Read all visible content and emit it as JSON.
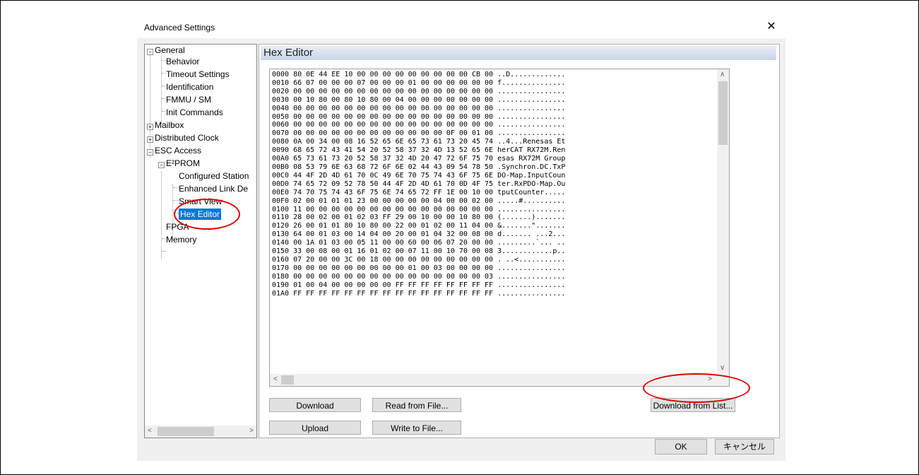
{
  "window": {
    "title": "Advanced Settings",
    "close_glyph": "✕"
  },
  "tree": {
    "items": [
      {
        "label": "General"
      },
      {
        "label": "Behavior"
      },
      {
        "label": "Timeout Settings"
      },
      {
        "label": "Identification"
      },
      {
        "label": "FMMU / SM"
      },
      {
        "label": "Init Commands"
      },
      {
        "label": "Mailbox"
      },
      {
        "label": "Distributed Clock"
      },
      {
        "label": "ESC Access"
      },
      {
        "label": "E²PROM"
      },
      {
        "label": "Configured Station"
      },
      {
        "label": "Enhanced Link De"
      },
      {
        "label": "Smart View"
      },
      {
        "label": "Hex Editor"
      },
      {
        "label": "FPGA"
      },
      {
        "label": "Memory"
      }
    ],
    "selected": "Hex Editor",
    "scroll_left": "<",
    "scroll_right": ">"
  },
  "content": {
    "header": "Hex Editor"
  },
  "hex": {
    "lines": [
      "0000 80 0E 44 EE 10 00 00 00 00 00 00 00 00 00 CB 00 ..D.............",
      "0010 66 07 00 00 00 07 00 00 00 01 00 00 00 00 00 00 f...............",
      "0020 00 00 00 00 00 00 00 00 00 00 00 00 00 00 00 00 ................",
      "0030 00 10 80 00 80 10 80 00 04 00 00 00 00 00 00 00 ................",
      "0040 00 00 00 00 00 00 00 00 00 00 00 00 00 00 00 00 ................",
      "0050 00 00 00 00 00 00 00 00 00 00 00 00 00 00 00 00 ................",
      "0060 00 00 00 00 00 00 00 00 00 00 00 00 00 00 00 00 ................",
      "0070 00 00 00 00 00 00 00 00 00 00 00 00 0F 00 01 00 ................",
      "0080 0A 00 34 00 08 16 52 65 6E 65 73 61 73 20 45 74 ..4...Renesas Et",
      "0090 68 65 72 43 41 54 20 52 58 37 32 4D 13 52 65 6E herCAT RX72M.Ren",
      "00A0 65 73 61 73 20 52 58 37 32 4D 20 47 72 6F 75 70 esas RX72M Group",
      "00B0 08 53 79 6E 63 68 72 6F 6E 02 44 43 09 54 78 50 .Synchron.DC.TxP",
      "00C0 44 4F 2D 4D 61 70 0C 49 6E 70 75 74 43 6F 75 6E DO-Map.InputCoun",
      "00D0 74 65 72 09 52 78 50 44 4F 2D 4D 61 70 0D 4F 75 ter.RxPDO-Map.Ou",
      "00E0 74 70 75 74 43 6F 75 6E 74 65 72 FF 1E 00 10 00 tputCounter.....",
      "00F0 02 00 01 01 01 23 00 00 00 00 00 04 00 00 02 00 .....#..........",
      "0100 11 00 00 00 00 00 00 00 00 00 00 00 00 00 00 00 ................",
      "0110 28 00 02 00 01 02 03 FF 29 00 10 00 00 10 80 00 (.......).......",
      "0120 26 00 01 01 80 10 80 00 22 00 01 02 00 11 04 00 &.......\".......",
      "0130 64 00 01 03 00 14 04 00 20 00 01 04 32 00 08 00 d....... ...2...",
      "0140 00 1A 01 03 00 05 11 00 00 60 00 06 07 20 00 00 .........`... ..",
      "0150 33 00 08 00 01 16 01 02 00 07 11 00 10 70 00 08 3............p..",
      "0160 07 20 00 00 3C 00 18 00 00 00 00 00 00 00 00 00 . ..<...........",
      "0170 00 00 00 00 00 00 00 00 00 01 00 03 00 00 00 00 ................",
      "0180 00 00 00 00 00 00 00 00 00 00 00 00 00 00 00 03 ................",
      "0190 01 00 04 00 00 00 00 00 FF FF FF FF FF FF FF FF ................",
      "01A0 FF FF FF FF FF FF FF FF FF FF FF FF FF FF FF FF ................"
    ],
    "scroll_up": "∧",
    "scroll_down": "∨",
    "scroll_left": "<",
    "scroll_right": ">"
  },
  "buttons": {
    "download": "Download",
    "upload": "Upload",
    "read_from_file": "Read from File...",
    "write_to_file": "Write to File...",
    "download_from_list": "Download from List..."
  },
  "footer": {
    "ok": "OK",
    "cancel": "キャンセル"
  },
  "colors": {
    "selection": "#0078d7",
    "highlight_oval": "#e00000"
  }
}
